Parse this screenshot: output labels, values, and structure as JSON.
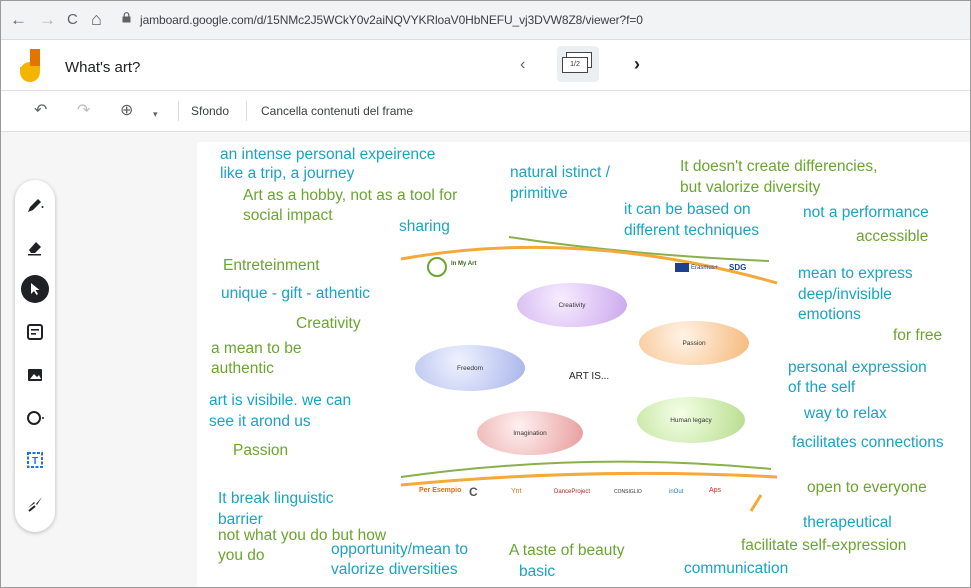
{
  "browser": {
    "back_icon": "←",
    "forward_icon": "→",
    "reload_icon": "C",
    "home_icon": "⌂",
    "url": "jamboard.google.com/d/15NMc2J5WCkY0v2aiNQVYKRloaV0HbNEFU_vj3DVW8Z8/viewer?f=0"
  },
  "app": {
    "title": "What's art?",
    "frame_indicator": "1/2",
    "prev_icon": "‹",
    "next_icon": "›"
  },
  "toolbar": {
    "undo_icon": "↶",
    "redo_icon": "↷",
    "zoom_icon": "⊕",
    "zoom_caret": "▾",
    "background_label": "Sfondo",
    "clear_label": "Cancella contenuti del frame"
  },
  "tools": [
    "pen-icon",
    "eraser-icon",
    "select-icon",
    "sticky-note-icon",
    "image-icon",
    "circle-icon",
    "text-box-icon",
    "laser-icon"
  ],
  "notes": [
    {
      "text": "an intense personal expeirence",
      "color": "#1aa3c4"
    },
    {
      "text": "like a trip, a journey",
      "color": "#1aa3c4"
    },
    {
      "text": "Art as a hobby, not as a tool for",
      "color": "#6aa530"
    },
    {
      "text": "social impact",
      "color": "#6aa530"
    },
    {
      "text": "natural istinct /",
      "color": "#1aa3c4"
    },
    {
      "text": "primitive",
      "color": "#1aa3c4"
    },
    {
      "text": "It doesn't create differencies,",
      "color": "#6aa530"
    },
    {
      "text": "but valorize diversity",
      "color": "#6aa530"
    },
    {
      "text": "sharing",
      "color": "#1aa3c4"
    },
    {
      "text": "it can be based on",
      "color": "#1aa3c4"
    },
    {
      "text": "different techniques",
      "color": "#1aa3c4"
    },
    {
      "text": "not a performance",
      "color": "#1aa3c4"
    },
    {
      "text": "accessible",
      "color": "#6aa530"
    },
    {
      "text": "Entreteinment",
      "color": "#6aa530"
    },
    {
      "text": "unique - gift - athentic",
      "color": "#1aa3c4"
    },
    {
      "text": "mean to express",
      "color": "#1aa3c4"
    },
    {
      "text": "deep/invisible",
      "color": "#1aa3c4"
    },
    {
      "text": "emotions",
      "color": "#1aa3c4"
    },
    {
      "text": "Creativity",
      "color": "#6aa530"
    },
    {
      "text": "for free",
      "color": "#6aa530"
    },
    {
      "text": "a mean to be",
      "color": "#6aa530"
    },
    {
      "text": "authentic",
      "color": "#6aa530"
    },
    {
      "text": "personal expression",
      "color": "#1aa3c4"
    },
    {
      "text": "of the self",
      "color": "#1aa3c4"
    },
    {
      "text": "art is visibile. we can",
      "color": "#1aa3c4"
    },
    {
      "text": "see it arond us",
      "color": "#1aa3c4"
    },
    {
      "text": "way to relax",
      "color": "#1aa3c4"
    },
    {
      "text": "facilitates connections",
      "color": "#1aa3c4"
    },
    {
      "text": "Passion",
      "color": "#6aa530"
    },
    {
      "text": "open to everyone",
      "color": "#6aa530"
    },
    {
      "text": "It break linguistic",
      "color": "#1aa3c4"
    },
    {
      "text": "barrier",
      "color": "#1aa3c4"
    },
    {
      "text": "therapeutical",
      "color": "#1aa3c4"
    },
    {
      "text": "not what you do but how",
      "color": "#6aa530"
    },
    {
      "text": "you do",
      "color": "#6aa530"
    },
    {
      "text": "opportunity/mean to",
      "color": "#1aa3c4"
    },
    {
      "text": "valorize diversities",
      "color": "#1aa3c4"
    },
    {
      "text": "A taste of beauty",
      "color": "#6aa530"
    },
    {
      "text": "basic",
      "color": "#1aa3c4"
    },
    {
      "text": "facilitate self-expression",
      "color": "#6aa530"
    },
    {
      "text": "communication",
      "color": "#1aa3c4"
    }
  ],
  "poster": {
    "center_label": "ART IS...",
    "ovals": [
      "Creativity",
      "Passion",
      "Freedom",
      "Human legacy",
      "Imagination"
    ],
    "logo_text": "In My Art",
    "erasmus_label": "Erasmus+",
    "sponsors": [
      "Per Esempio",
      "C",
      "Ynt",
      "DanceProject",
      "CONSIGLIO",
      "inOut",
      "Aps"
    ]
  }
}
